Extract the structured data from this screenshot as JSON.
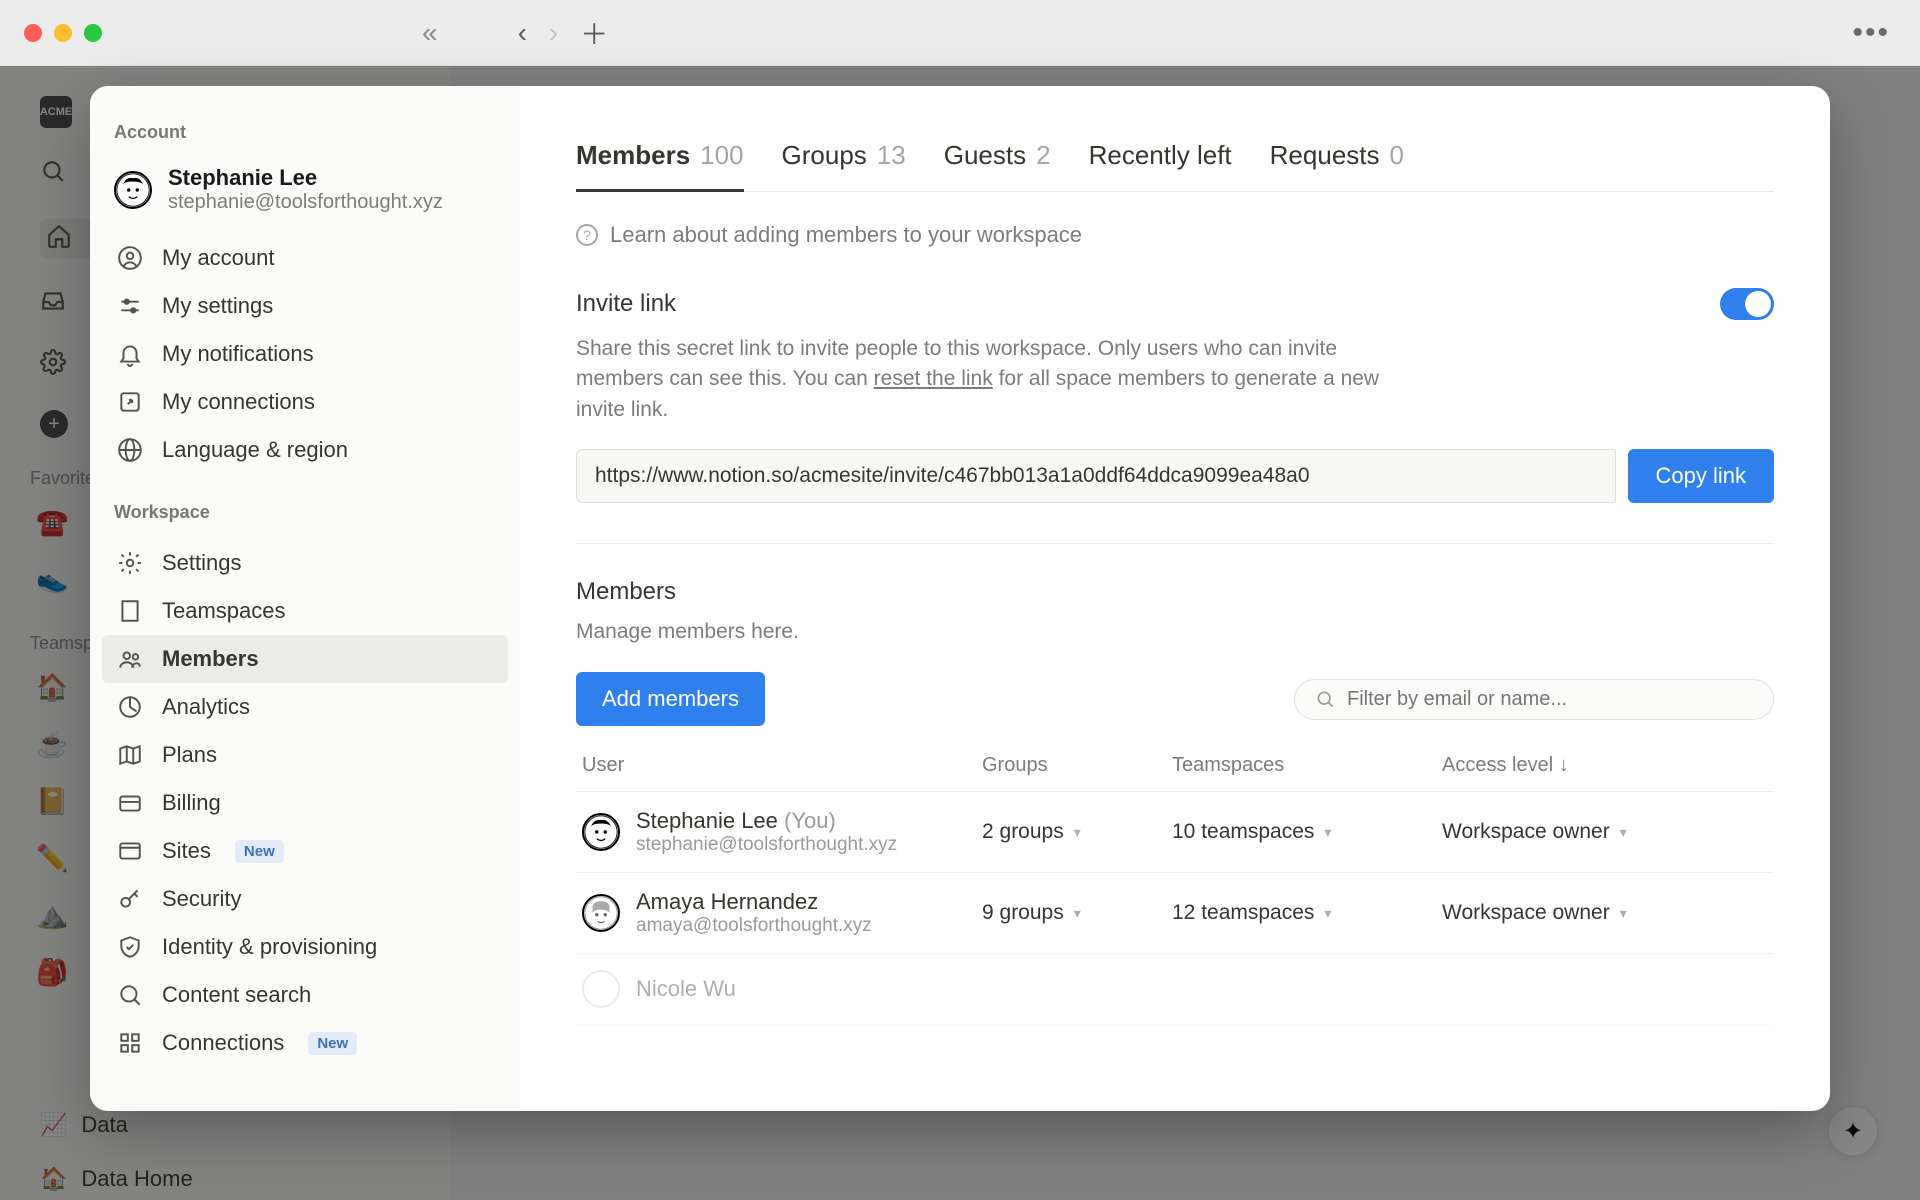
{
  "sidebar_sections": {
    "favorites_label": "Favorites",
    "teamspaces_label": "Teamspaces"
  },
  "underlay_bottom": {
    "data_label": "Data",
    "data_home_label": "Data Home"
  },
  "settings_sidebar": {
    "account_heading": "Account",
    "profile": {
      "name": "Stephanie Lee",
      "email": "stephanie@toolsforthought.xyz"
    },
    "account_items": [
      {
        "key": "my-account",
        "label": "My account"
      },
      {
        "key": "my-settings",
        "label": "My settings"
      },
      {
        "key": "my-notifications",
        "label": "My notifications"
      },
      {
        "key": "my-connections",
        "label": "My connections"
      },
      {
        "key": "language-region",
        "label": "Language & region"
      }
    ],
    "workspace_heading": "Workspace",
    "workspace_items": [
      {
        "key": "settings",
        "label": "Settings"
      },
      {
        "key": "teamspaces",
        "label": "Teamspaces"
      },
      {
        "key": "members",
        "label": "Members",
        "active": true
      },
      {
        "key": "analytics",
        "label": "Analytics"
      },
      {
        "key": "plans",
        "label": "Plans"
      },
      {
        "key": "billing",
        "label": "Billing"
      },
      {
        "key": "sites",
        "label": "Sites",
        "badge": "New"
      },
      {
        "key": "security",
        "label": "Security"
      },
      {
        "key": "identity",
        "label": "Identity & provisioning"
      },
      {
        "key": "content-search",
        "label": "Content search"
      },
      {
        "key": "connections",
        "label": "Connections",
        "badge": "New"
      }
    ]
  },
  "tabs": [
    {
      "label": "Members",
      "count": "100",
      "active": true
    },
    {
      "label": "Groups",
      "count": "13"
    },
    {
      "label": "Guests",
      "count": "2"
    },
    {
      "label": "Recently left",
      "count": ""
    },
    {
      "label": "Requests",
      "count": "0"
    }
  ],
  "help_text": "Learn about adding members to your workspace",
  "invite": {
    "title": "Invite link",
    "desc_1": "Share this secret link to invite people to this workspace. Only users who can invite members can see this. You can ",
    "reset": "reset the link",
    "desc_2": " for all space members to generate a new invite link.",
    "url": "https://www.notion.so/acmesite/invite/c467bb013a1a0ddf64ddca9099ea48a0",
    "copy_label": "Copy link"
  },
  "members_section": {
    "title": "Members",
    "subtitle": "Manage members here.",
    "add_button": "Add members",
    "filter_placeholder": "Filter by email or name...",
    "columns": {
      "user": "User",
      "groups": "Groups",
      "teamspaces": "Teamspaces",
      "access": "Access level"
    },
    "rows": [
      {
        "name": "Stephanie Lee",
        "you": "(You)",
        "email": "stephanie@toolsforthought.xyz",
        "groups": "2 groups",
        "teamspaces": "10 teamspaces",
        "access": "Workspace owner"
      },
      {
        "name": "Amaya Hernandez",
        "you": "",
        "email": "amaya@toolsforthought.xyz",
        "groups": "9 groups",
        "teamspaces": "12 teamspaces",
        "access": "Workspace owner"
      }
    ],
    "partial_name": "Nicole Wu"
  }
}
